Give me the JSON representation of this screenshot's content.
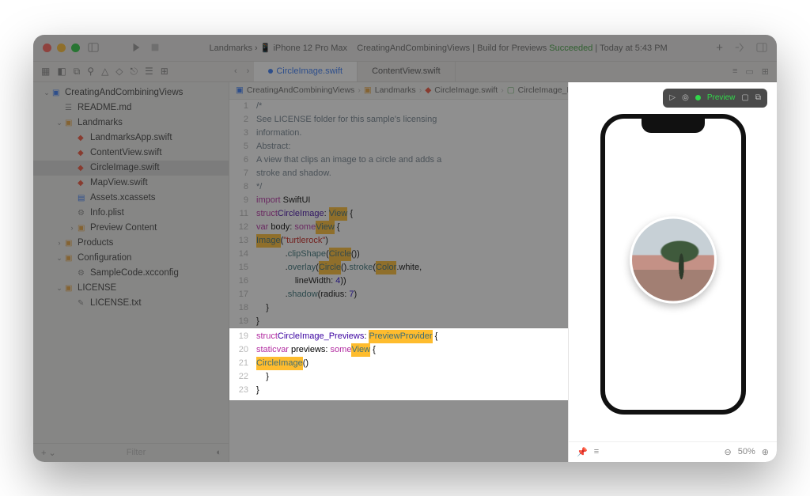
{
  "title": {
    "project": "Landmarks",
    "device": "iPhone 12 Pro Max",
    "scheme": "CreatingAndCombiningViews",
    "build": "Build for Previews",
    "status": "Succeeded",
    "time": "Today at 5:43 PM"
  },
  "tabs": {
    "active": "CircleImage.swift",
    "other": "ContentView.swift"
  },
  "sidebar": {
    "items": [
      {
        "label": "CreatingAndCombiningViews",
        "type": "proj",
        "depth": 1,
        "open": true
      },
      {
        "label": "README.md",
        "type": "md",
        "depth": 2
      },
      {
        "label": "Landmarks",
        "type": "folder",
        "depth": 2,
        "open": true
      },
      {
        "label": "LandmarksApp.swift",
        "type": "swift",
        "depth": 3
      },
      {
        "label": "ContentView.swift",
        "type": "swift",
        "depth": 3
      },
      {
        "label": "CircleImage.swift",
        "type": "swift",
        "depth": 3,
        "selected": true
      },
      {
        "label": "MapView.swift",
        "type": "swift",
        "depth": 3
      },
      {
        "label": "Assets.xcassets",
        "type": "assets",
        "depth": 3
      },
      {
        "label": "Info.plist",
        "type": "plist",
        "depth": 3
      },
      {
        "label": "Preview Content",
        "type": "folder",
        "depth": 3
      },
      {
        "label": "Products",
        "type": "folder",
        "depth": 2
      },
      {
        "label": "Configuration",
        "type": "folder",
        "depth": 2,
        "open": true
      },
      {
        "label": "SampleCode.xcconfig",
        "type": "cfg",
        "depth": 3
      },
      {
        "label": "LICENSE",
        "type": "folder",
        "depth": 2,
        "open": true
      },
      {
        "label": "LICENSE.txt",
        "type": "txt",
        "depth": 3
      }
    ],
    "filter": "Filter"
  },
  "crumbs": {
    "a": "CreatingAndCombiningViews",
    "b": "Landmarks",
    "c": "CircleImage.swift",
    "d": "CircleImage_Previews"
  },
  "code": {
    "start": 1,
    "lines": [
      {
        "c": "/*"
      },
      {
        "c": "See LICENSE folder for this sample's licensing"
      },
      {
        "c": "information."
      },
      {
        "r": ""
      },
      {
        "c": "Abstract:"
      },
      {
        "c": "A view that clips an image to a circle and adds a"
      },
      {
        "c": "stroke and shadow."
      },
      {
        "c": "*/"
      },
      {
        "r": "<span class='kw'>import</span> SwiftUI"
      },
      {
        "r": ""
      },
      {
        "r": "<span class='kw'>struct</span> <span class='nm'>CircleImage</span>: <span class='ty'>View</span> {"
      },
      {
        "r": "    <span class='kw'>var</span> body: <span class='kw'>some</span> <span class='ty'>View</span> {"
      },
      {
        "r": "        <span class='ty'>Image</span>(<span class='str'>\"turtlerock\"</span>)"
      },
      {
        "r": "            .<span class='id'>clipShape</span>(<span class='ty'>Circle</span>())"
      },
      {
        "r": "            .<span class='id'>overlay</span>(<span class='ty'>Circle</span>().<span class='id'>stroke</span>(<span class='ty'>Color</span>.white,"
      },
      {
        "r": "                lineWidth: <span class='num'>4</span>))"
      },
      {
        "r": "            .<span class='id'>shadow</span>(radius: <span class='num'>7</span>)"
      },
      {
        "r": "    }"
      },
      {
        "r": "}"
      }
    ],
    "hl_start": 19,
    "hl": [
      {
        "r": "<span class='kw'>struct</span> <span class='nm'>CircleImage_Previews</span>: <span class='ty'>PreviewProvider</span> {"
      },
      {
        "r": "    <span class='kw'>static</span> <span class='kw'>var</span> previews: <span class='kw'>some</span> <span class='ty'>View</span> {"
      },
      {
        "r": "        <span class='ty'>CircleImage</span>()"
      },
      {
        "r": "    }"
      },
      {
        "r": "}"
      }
    ]
  },
  "preview": {
    "label": "Preview",
    "zoom": "50%"
  }
}
